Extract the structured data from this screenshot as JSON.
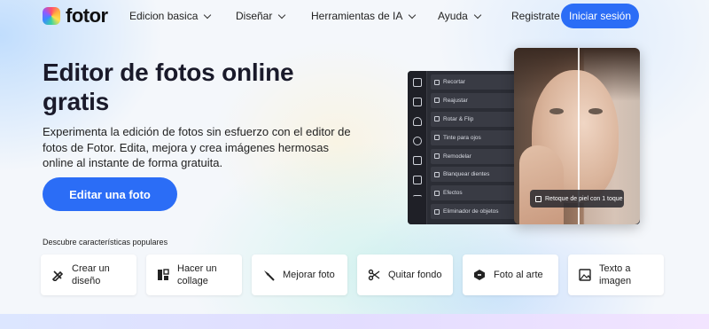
{
  "brand": {
    "name": "fotor"
  },
  "nav": {
    "menu": [
      {
        "label": "Edicion basica"
      },
      {
        "label": "Diseñar"
      },
      {
        "label": "Herramientas de IA"
      },
      {
        "label": "Ayuda"
      }
    ],
    "register": "Registrate",
    "login": "Iniciar sesión"
  },
  "hero": {
    "title": "Editor de fotos online gratis",
    "description": "Experimenta la edición de fotos sin esfuerzo con el editor de fotos de Fotor. Edita, mejora y crea imágenes hermosas online al instante de forma gratuita.",
    "cta": "Editar una foto"
  },
  "preview": {
    "tools": [
      {
        "label": "Recortar",
        "icon": "crop-icon"
      },
      {
        "label": "Reajustar",
        "icon": "resize-icon"
      },
      {
        "label": "Rotar & Flip",
        "icon": "rotate-icon"
      },
      {
        "label": "Tinte para ojos",
        "icon": "eye-tint-icon"
      },
      {
        "label": "Remodelar",
        "icon": "reshape-icon"
      },
      {
        "label": "Blanquear dientes",
        "icon": "teeth-icon"
      },
      {
        "label": "Efectos",
        "icon": "effects-icon"
      },
      {
        "label": "Eliminador de objetos",
        "icon": "eraser-icon"
      }
    ],
    "badge": "Retoque de piel con 1 toque"
  },
  "features": {
    "heading": "Descubre características populares",
    "cards": [
      {
        "label": "Crear un diseño",
        "icon": "design-pen-icon"
      },
      {
        "label": "Hacer un collage",
        "icon": "collage-icon"
      },
      {
        "label": "Mejorar foto",
        "icon": "magic-wand-icon"
      },
      {
        "label": "Quitar fondo",
        "icon": "scissors-icon"
      },
      {
        "label": "Foto al arte",
        "icon": "art-icon"
      },
      {
        "label": "Texto a imagen",
        "icon": "text-image-icon"
      }
    ]
  },
  "colors": {
    "accent": "#2b6df6"
  }
}
